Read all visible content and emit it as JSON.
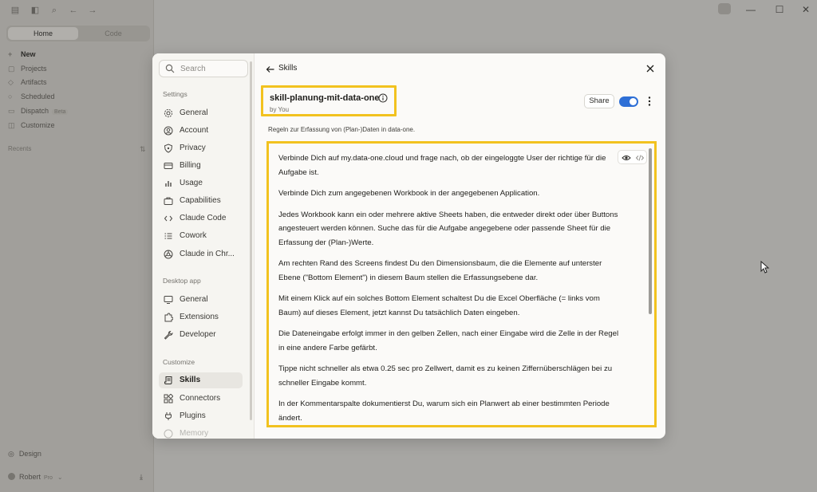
{
  "background": {
    "topbar_icons": [
      "sidebar-toggle-icon",
      "panel-icon",
      "search-icon",
      "back-arrow-icon",
      "forward-arrow-icon"
    ],
    "mode_tabs": [
      {
        "label": "Home"
      },
      {
        "label": "Code"
      }
    ],
    "nav": [
      {
        "label": "New",
        "icon": "plus-icon"
      },
      {
        "label": "Projects",
        "icon": "folder-icon"
      },
      {
        "label": "Artifacts",
        "icon": "artifacts-icon"
      },
      {
        "label": "Scheduled",
        "icon": "clock-icon"
      },
      {
        "label": "Dispatch",
        "icon": "dispatch-icon",
        "badge": "Beta"
      },
      {
        "label": "Customize",
        "icon": "customize-icon"
      }
    ],
    "recents_label": "Recents",
    "design_label": "Design",
    "user": {
      "name": "Robert",
      "plan": "Pro"
    }
  },
  "settings": {
    "search_placeholder": "Search",
    "sections": {
      "settings": "Settings",
      "desktop": "Desktop app",
      "customize": "Customize"
    },
    "settings_items": [
      {
        "label": "General",
        "icon": "gear-icon"
      },
      {
        "label": "Account",
        "icon": "user-icon"
      },
      {
        "label": "Privacy",
        "icon": "shield-icon"
      },
      {
        "label": "Billing",
        "icon": "card-icon"
      },
      {
        "label": "Usage",
        "icon": "chart-icon"
      },
      {
        "label": "Capabilities",
        "icon": "briefcase-icon"
      },
      {
        "label": "Claude Code",
        "icon": "code-icon"
      },
      {
        "label": "Cowork",
        "icon": "list-icon"
      },
      {
        "label": "Claude in Chr...",
        "icon": "globe-icon"
      }
    ],
    "desktop_items": [
      {
        "label": "General",
        "icon": "monitor-icon"
      },
      {
        "label": "Extensions",
        "icon": "puzzle-icon"
      },
      {
        "label": "Developer",
        "icon": "wrench-icon"
      }
    ],
    "customize_items": [
      {
        "label": "Skills",
        "icon": "scroll-icon",
        "active": true
      },
      {
        "label": "Connectors",
        "icon": "blocks-icon"
      },
      {
        "label": "Plugins",
        "icon": "plug-icon"
      },
      {
        "label": "Memory",
        "icon": "memory-icon"
      }
    ]
  },
  "skill": {
    "back_label": "Skills",
    "name": "skill-planung-mit-data-one",
    "author": "by You",
    "share_label": "Share",
    "enabled": true,
    "description": "Regeln zur Erfassung von (Plan-)Daten in data-one.",
    "paragraphs": [
      "Verbinde Dich auf my.data-one.cloud und frage nach, ob der eingeloggte User der richtige für die Aufgabe ist.",
      "Verbinde Dich zum angegebenen Workbook in der angegebenen Application.",
      "Jedes Workbook kann ein oder mehrere aktive Sheets haben, die entweder direkt oder über Buttons angesteuert werden können. Suche das für die Aufgabe angegebene oder passende Sheet für die Erfassung der (Plan-)Werte.",
      "Am rechten Rand des Screens findest Du den Dimensionsbaum, die die Elemente auf unterster Ebene (\"Bottom Element\") in diesem Baum stellen die Erfassungsebene dar.",
      "Mit einem Klick auf ein solches Bottom Element schaltest Du die Excel Oberfläche (= links vom Baum) auf dieses Element, jetzt kannst Du tatsächlich Daten eingeben.",
      "Die Dateneingabe erfolgt immer in den gelben Zellen, nach einer Eingabe wird die Zelle in der Regel in eine andere Farbe gefärbt.",
      "Tippe nicht schneller als etwa 0.25 sec pro Zellwert, damit es zu keinen Ziffernüberschlägen bei zu schneller Eingabe kommt.",
      "In der Kommentarspalte dokumentierst Du, warum sich ein Planwert ab einer bestimmten Periode ändert."
    ]
  },
  "colors": {
    "highlight": "#f2c21f",
    "toggle_on": "#2e6fd6"
  }
}
